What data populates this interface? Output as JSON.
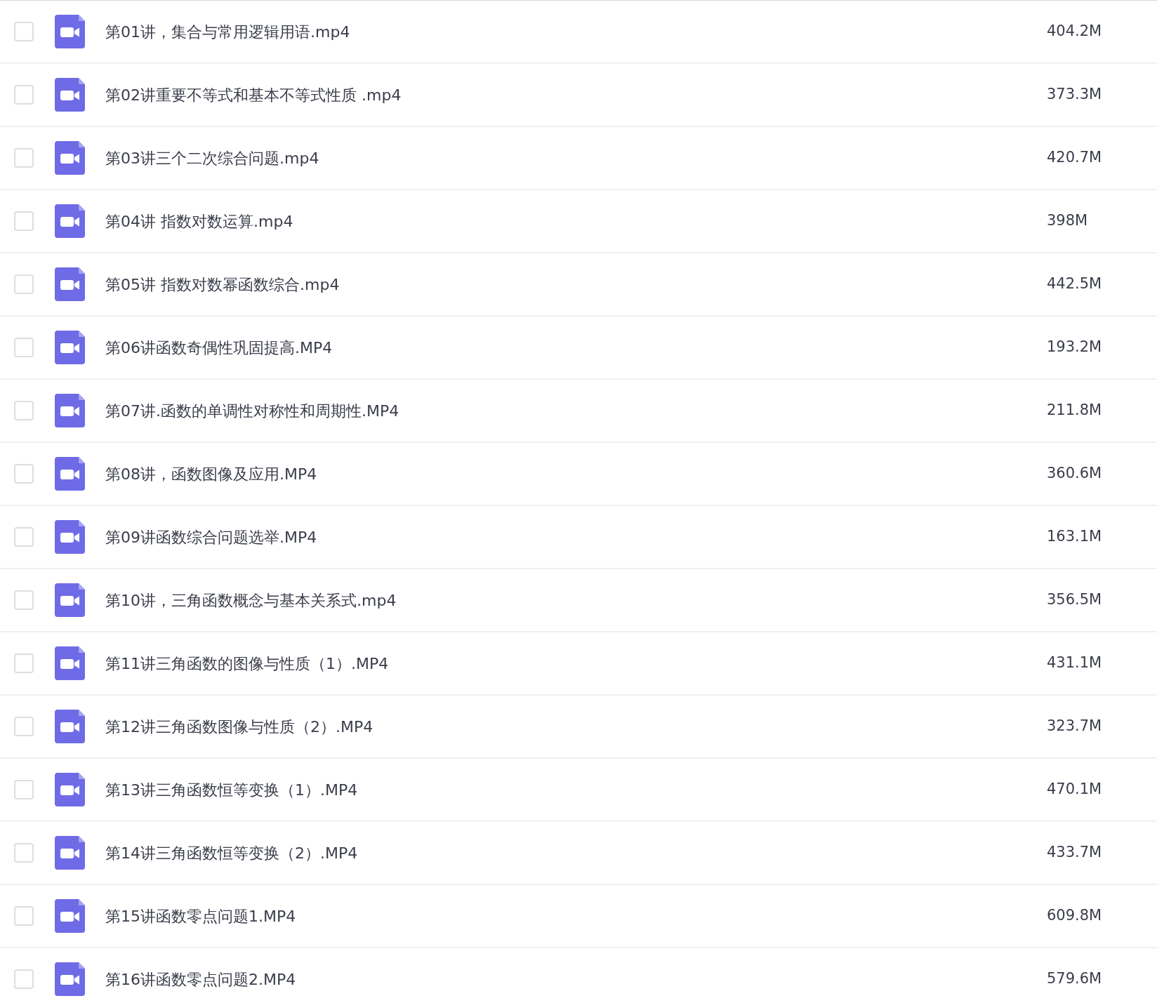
{
  "files": [
    {
      "name": "第01讲，集合与常用逻辑用语.mp4",
      "size": "404.2M",
      "checked": false
    },
    {
      "name": "第02讲重要不等式和基本不等式性质 .mp4",
      "size": "373.3M",
      "checked": false
    },
    {
      "name": "第03讲三个二次综合问题.mp4",
      "size": "420.7M",
      "checked": false
    },
    {
      "name": "第04讲 指数对数运算.mp4",
      "size": "398M",
      "checked": false
    },
    {
      "name": "第05讲 指数对数幂函数综合.mp4",
      "size": "442.5M",
      "checked": false
    },
    {
      "name": "第06讲函数奇偶性巩固提高.MP4",
      "size": "193.2M",
      "checked": false
    },
    {
      "name": "第07讲.函数的单调性对称性和周期性.MP4",
      "size": "211.8M",
      "checked": false
    },
    {
      "name": "第08讲，函数图像及应用.MP4",
      "size": "360.6M",
      "checked": false
    },
    {
      "name": "第09讲函数综合问题选举.MP4",
      "size": "163.1M",
      "checked": false
    },
    {
      "name": "第10讲，三角函数概念与基本关系式.mp4",
      "size": "356.5M",
      "checked": false
    },
    {
      "name": "第11讲三角函数的图像与性质（1）.MP4",
      "size": "431.1M",
      "checked": false
    },
    {
      "name": "第12讲三角函数图像与性质（2）.MP4",
      "size": "323.7M",
      "checked": false
    },
    {
      "name": "第13讲三角函数恒等变换（1）.MP4",
      "size": "470.1M",
      "checked": false
    },
    {
      "name": "第14讲三角函数恒等变换（2）.MP4",
      "size": "433.7M",
      "checked": false
    },
    {
      "name": "第15讲函数零点问题1.MP4",
      "size": "609.8M",
      "checked": false
    },
    {
      "name": "第16讲函数零点问题2.MP4",
      "size": "579.6M",
      "checked": false
    }
  ]
}
